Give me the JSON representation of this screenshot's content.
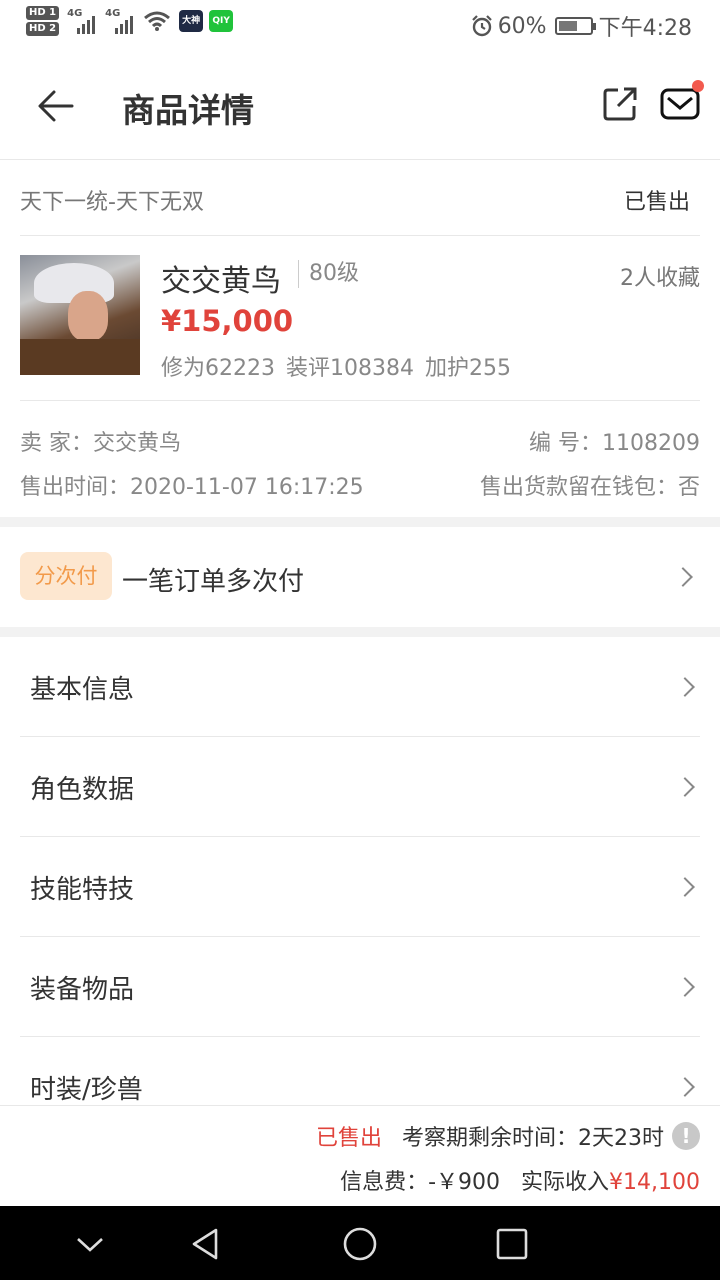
{
  "status_bar": {
    "hd1": "HD 1",
    "hd2": "HD 2",
    "net1": "4G",
    "net2": "4G",
    "app1": "大神",
    "app2": "QIY",
    "battery": "60%",
    "time": "下午4:28"
  },
  "header": {
    "title": "商品详情"
  },
  "product": {
    "server": "天下一统-天下无双",
    "status": "已售出",
    "name": "交交黄鸟",
    "level": "80级",
    "favorites": "2人收藏",
    "price": "¥15,000",
    "stats": "修为62223 装评108384 加护255"
  },
  "info": {
    "seller": "卖 家：交交黄鸟",
    "serial": "编 号：1108209",
    "sold_time": "售出时间：2020-11-07 16:17:25",
    "wallet": "售出货款留在钱包：否"
  },
  "payment": {
    "badge": "分次付",
    "text": "一笔订单多次付"
  },
  "menu": [
    {
      "label": "基本信息"
    },
    {
      "label": "角色数据"
    },
    {
      "label": "技能特技"
    },
    {
      "label": "装备物品"
    },
    {
      "label": "时装/珍兽"
    }
  ],
  "bottom": {
    "sold": "已售出",
    "remaining": "考察期剩余时间：2天23时",
    "warn": "!",
    "fee": "信息费：-￥900",
    "income_label": "实际收入",
    "income": "¥14,100"
  },
  "colors": {
    "accent_red": "#e0433b",
    "badge_bg": "#fde7d0",
    "badge_text": "#f29a4a"
  }
}
